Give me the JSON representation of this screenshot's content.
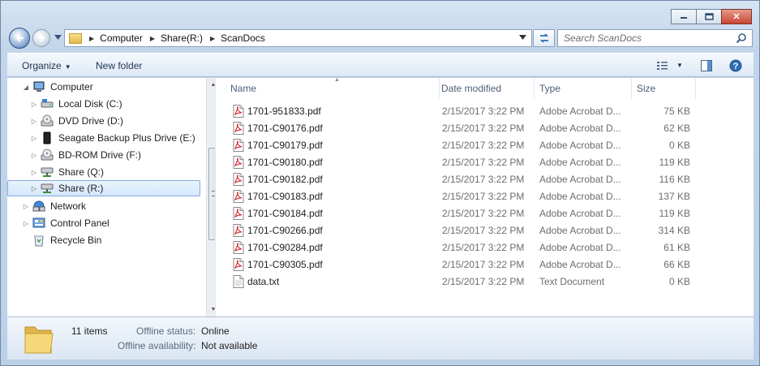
{
  "window": {
    "caption_buttons": {
      "minimize": "▭",
      "maximize": "▢",
      "close": "✕"
    }
  },
  "address": {
    "breadcrumbs": [
      "Computer",
      "Share(R:)",
      "ScanDocs"
    ]
  },
  "search": {
    "placeholder": "Search ScanDocs"
  },
  "toolbar": {
    "organize_label": "Organize",
    "new_folder_label": "New folder"
  },
  "nav": {
    "items": [
      {
        "label": "Computer",
        "icon": "computer-icon",
        "expanded": true
      },
      {
        "label": "Local Disk (C:)",
        "icon": "local-disk-icon"
      },
      {
        "label": "DVD Drive (D:)",
        "icon": "dvd-drive-icon"
      },
      {
        "label": "Seagate Backup Plus Drive (E:)",
        "icon": "external-drive-icon"
      },
      {
        "label": "BD-ROM Drive (F:)",
        "icon": "bd-drive-icon"
      },
      {
        "label": "Share (Q:)",
        "icon": "network-drive-icon"
      },
      {
        "label": "Share (R:)",
        "icon": "network-drive-icon",
        "selected": true
      },
      {
        "label": "Network",
        "icon": "network-icon"
      },
      {
        "label": "Control Panel",
        "icon": "control-panel-icon"
      },
      {
        "label": "Recycle Bin",
        "icon": "recycle-bin-icon"
      }
    ]
  },
  "columns": {
    "name": "Name",
    "date_modified": "Date modified",
    "type": "Type",
    "size": "Size"
  },
  "files": [
    {
      "name": "1701-951833.pdf",
      "date": "2/15/2017 3:22 PM",
      "type": "Adobe Acrobat D...",
      "size": "75 KB",
      "icon": "pdf-icon"
    },
    {
      "name": "1701-C90176.pdf",
      "date": "2/15/2017 3:22 PM",
      "type": "Adobe Acrobat D...",
      "size": "62 KB",
      "icon": "pdf-icon"
    },
    {
      "name": "1701-C90179.pdf",
      "date": "2/15/2017 3:22 PM",
      "type": "Adobe Acrobat D...",
      "size": "0 KB",
      "icon": "pdf-icon"
    },
    {
      "name": "1701-C90180.pdf",
      "date": "2/15/2017 3:22 PM",
      "type": "Adobe Acrobat D...",
      "size": "119 KB",
      "icon": "pdf-icon"
    },
    {
      "name": "1701-C90182.pdf",
      "date": "2/15/2017 3:22 PM",
      "type": "Adobe Acrobat D...",
      "size": "116 KB",
      "icon": "pdf-icon"
    },
    {
      "name": "1701-C90183.pdf",
      "date": "2/15/2017 3:22 PM",
      "type": "Adobe Acrobat D...",
      "size": "137 KB",
      "icon": "pdf-icon"
    },
    {
      "name": "1701-C90184.pdf",
      "date": "2/15/2017 3:22 PM",
      "type": "Adobe Acrobat D...",
      "size": "119 KB",
      "icon": "pdf-icon"
    },
    {
      "name": "1701-C90266.pdf",
      "date": "2/15/2017 3:22 PM",
      "type": "Adobe Acrobat D...",
      "size": "314 KB",
      "icon": "pdf-icon"
    },
    {
      "name": "1701-C90284.pdf",
      "date": "2/15/2017 3:22 PM",
      "type": "Adobe Acrobat D...",
      "size": "61 KB",
      "icon": "pdf-icon"
    },
    {
      "name": "1701-C90305.pdf",
      "date": "2/15/2017 3:22 PM",
      "type": "Adobe Acrobat D...",
      "size": "66 KB",
      "icon": "pdf-icon"
    },
    {
      "name": "data.txt",
      "date": "2/15/2017 3:22 PM",
      "type": "Text Document",
      "size": "0 KB",
      "icon": "text-file-icon"
    }
  ],
  "details": {
    "item_count": "11 items",
    "offline_status_label": "Offline status:",
    "offline_status_value": "Online",
    "offline_availability_label": "Offline availability:",
    "offline_availability_value": "Not available"
  },
  "colors": {
    "accent": "#2f6db5",
    "selection_bg": "#d3e7fb",
    "selection_border": "#84acdd",
    "pdf_red": "#d0202a"
  }
}
